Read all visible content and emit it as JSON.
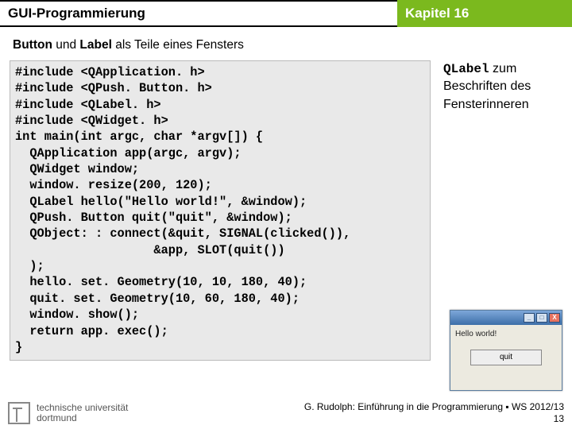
{
  "header": {
    "left": "GUI-Programmierung",
    "right": "Kapitel 16"
  },
  "subtitle": {
    "bold": "Button",
    "plain_mid": " und ",
    "bold2": "Label",
    "plain_end": " als Teile eines Fensters"
  },
  "code": "#include <QApplication. h>\n#include <QPush. Button. h>\n#include <QLabel. h>\n#include <QWidget. h>\nint main(int argc, char *argv[]) {\n  QApplication app(argc, argv);\n  QWidget window;\n  window. resize(200, 120);\n  QLabel hello(\"Hello world!\", &window);\n  QPush. Button quit(\"quit\", &window);\n  QObject: : connect(&quit, SIGNAL(clicked()),\n                   &app, SLOT(quit())\n  );\n  hello. set. Geometry(10, 10, 180, 40);\n  quit. set. Geometry(10, 60, 180, 40);\n  window. show();\n  return app. exec();\n}",
  "side": {
    "mono": "QLabel",
    "text1": " zum",
    "text2": "Beschriften des",
    "text3": "Fensterinneren"
  },
  "mini": {
    "label": "Hello world!",
    "quit": "quit",
    "min": "_",
    "max": "□",
    "close": "X"
  },
  "footer": {
    "line1": "G. Rudolph: Einführung in die Programmierung ▪ WS 2012/13",
    "line2": "13"
  },
  "logo": {
    "line1": "technische universität",
    "line2": "dortmund"
  }
}
